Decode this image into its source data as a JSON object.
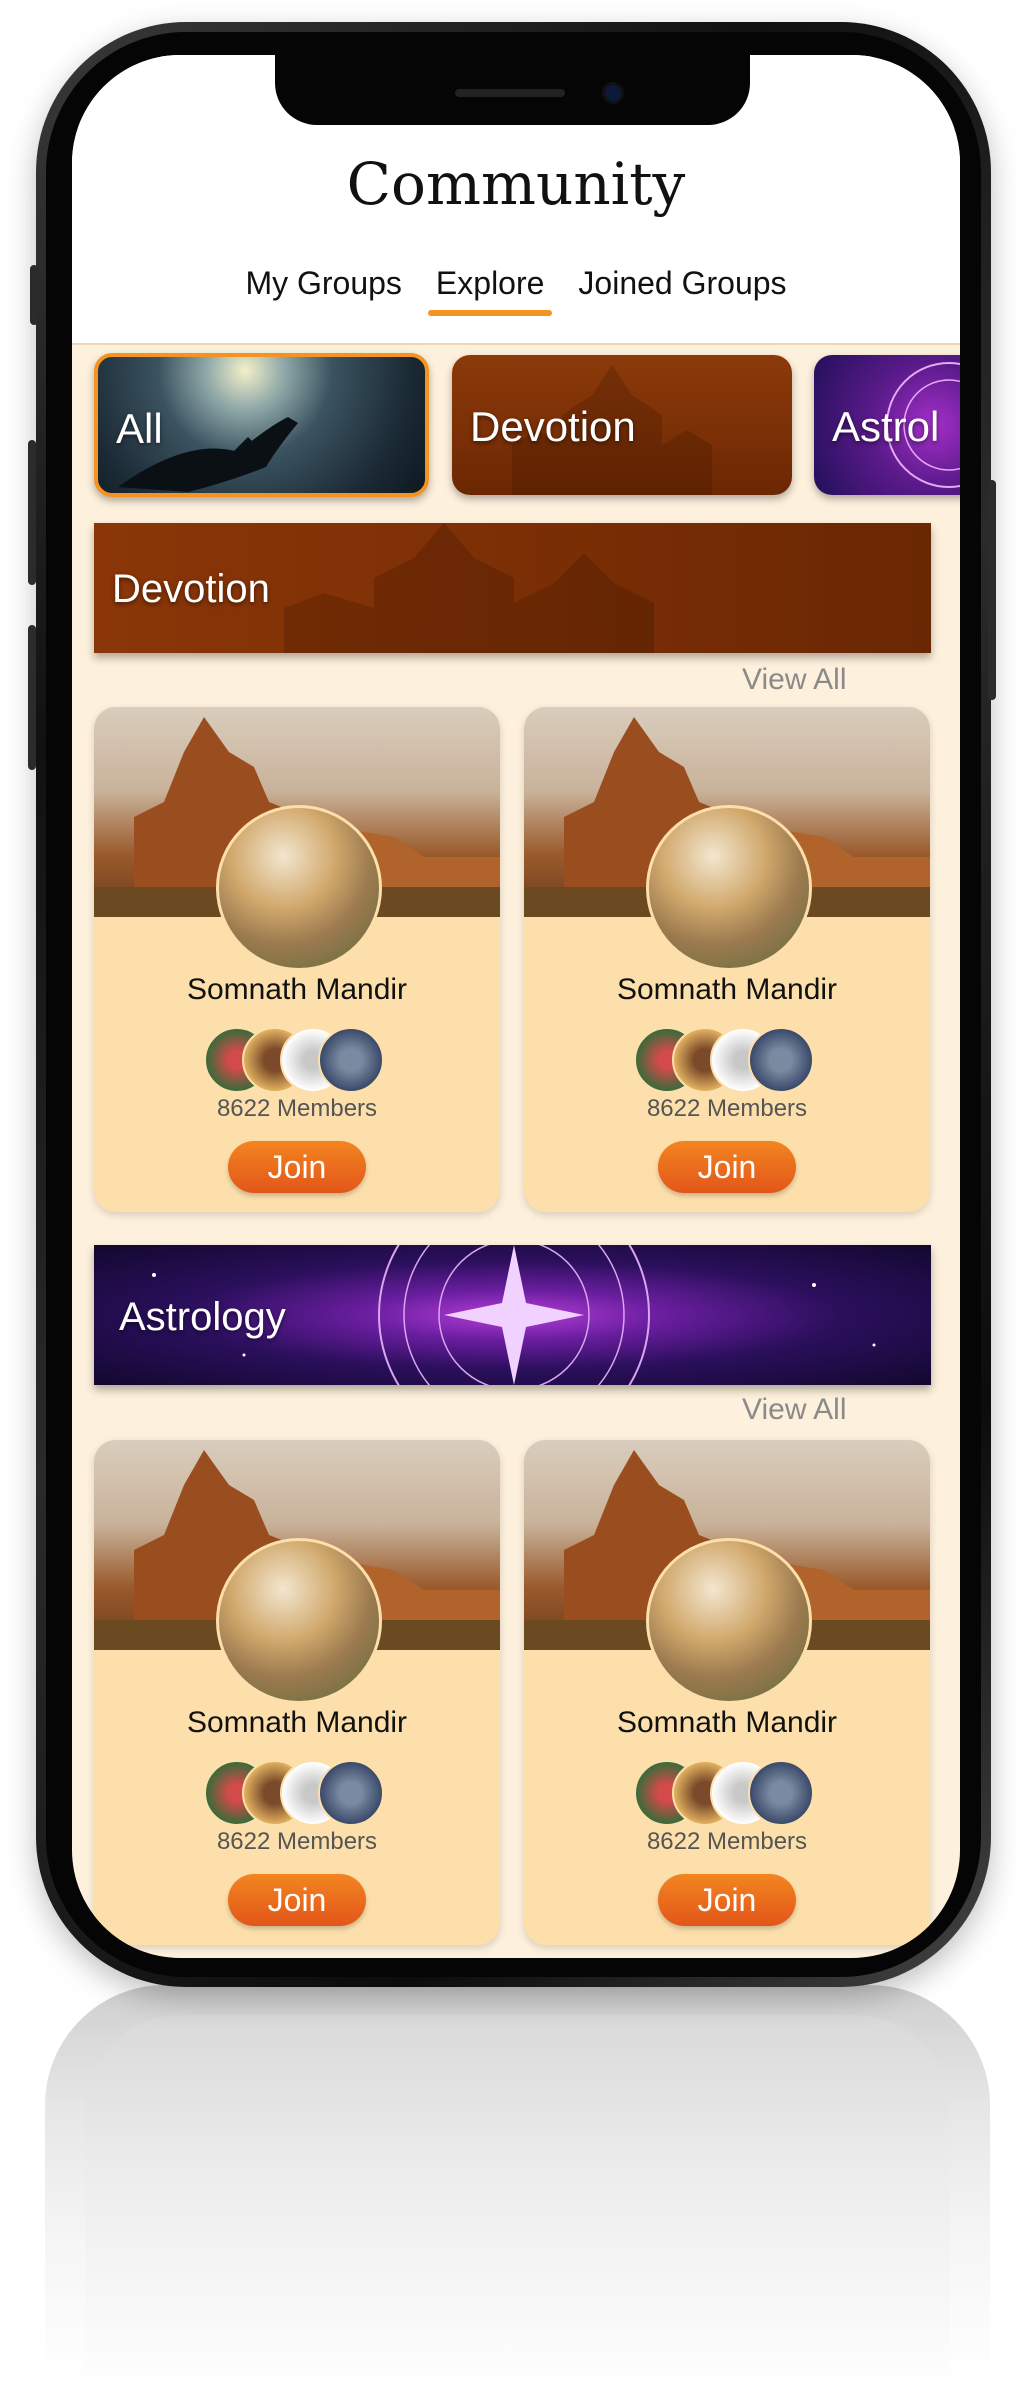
{
  "header": {
    "title": "Community",
    "tabs": [
      {
        "label": "My Groups"
      },
      {
        "label": "Explore"
      },
      {
        "label": "Joined Groups"
      }
    ],
    "active_tab": "Explore"
  },
  "categories": [
    {
      "label": "All",
      "selected": true
    },
    {
      "label": "Devotion"
    },
    {
      "label": "Astrol"
    }
  ],
  "sections": [
    {
      "title": "Devotion",
      "view_all": "View All",
      "groups": [
        {
          "name": "Somnath Mandir",
          "members": "8622 Members",
          "join_label": "Join"
        },
        {
          "name": "Somnath Mandir",
          "members": "8622 Members",
          "join_label": "Join"
        }
      ]
    },
    {
      "title": "Astrology",
      "view_all": "View All",
      "groups": [
        {
          "name": "Somnath Mandir",
          "members": "8622 Members",
          "join_label": "Join"
        },
        {
          "name": "Somnath Mandir",
          "members": "8622 Members",
          "join_label": "Join"
        }
      ]
    }
  ],
  "colors": {
    "accent": "#f39321",
    "join_button": "#e2561a",
    "background": "#fdf0dc",
    "card": "#fddfab"
  }
}
